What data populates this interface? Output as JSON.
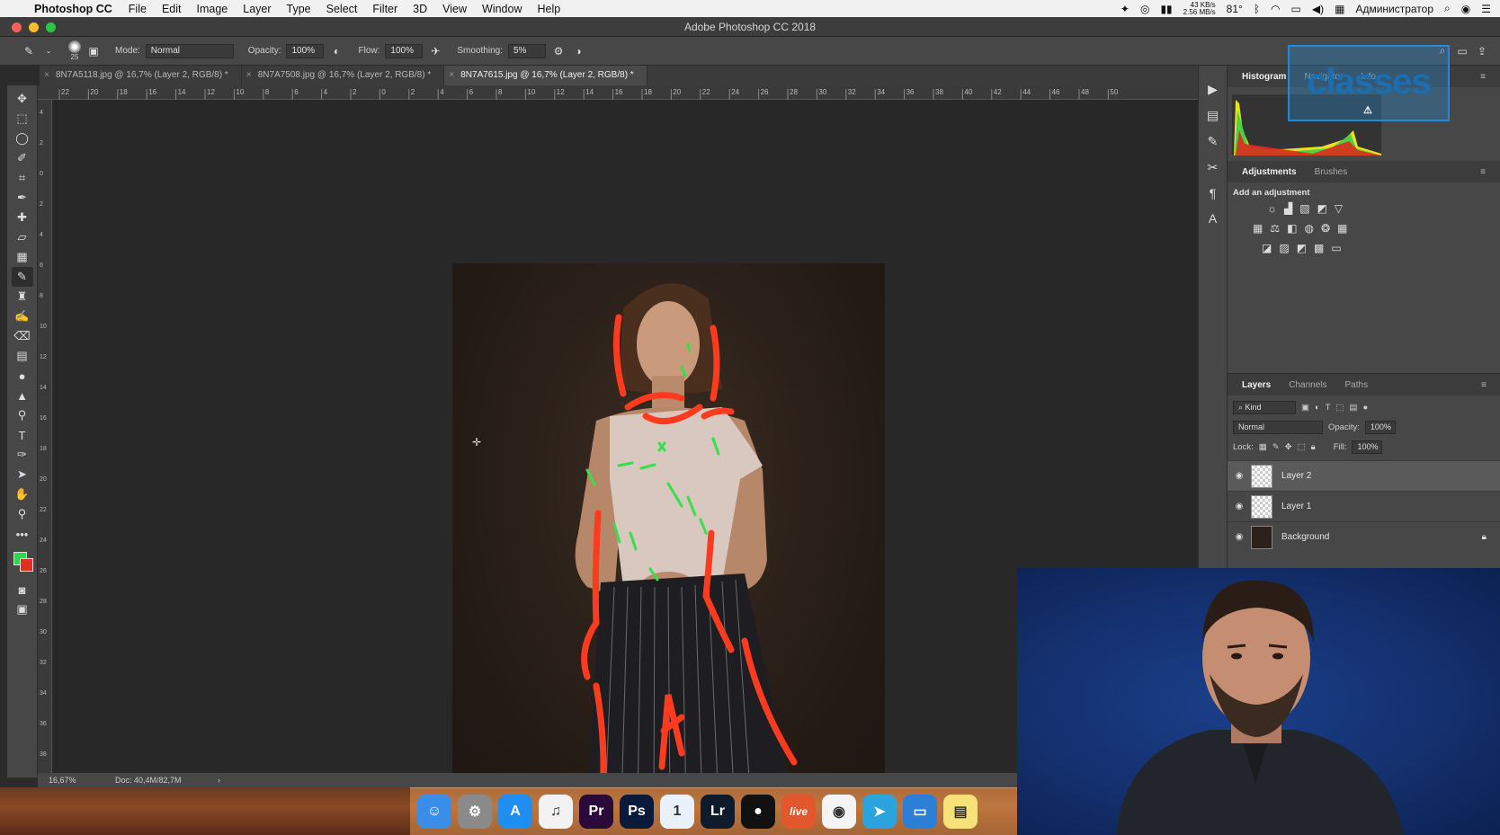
{
  "menubar": {
    "app_name": "Photoshop CC",
    "items": [
      "File",
      "Edit",
      "Image",
      "Layer",
      "Type",
      "Select",
      "Filter",
      "3D",
      "View",
      "Window",
      "Help"
    ],
    "net_up": "43 KB/s",
    "net_down": "2.56 MB/s",
    "temp": "81°",
    "user": "Администратор"
  },
  "window": {
    "title": "Adobe Photoshop CC 2018"
  },
  "options": {
    "brush_size": "25",
    "mode_label": "Mode:",
    "mode_value": "Normal",
    "opacity_label": "Opacity:",
    "opacity_value": "100%",
    "flow_label": "Flow:",
    "flow_value": "100%",
    "smoothing_label": "Smoothing:",
    "smoothing_value": "5%"
  },
  "tabs": [
    {
      "label": "8N7A5118.jpg @ 16,7% (Layer 2, RGB/8) *",
      "active": false
    },
    {
      "label": "8N7A7508.jpg @ 16,7% (Layer 2, RGB/8) *",
      "active": false
    },
    {
      "label": "8N7A7615.jpg @ 16,7% (Layer 2, RGB/8) *",
      "active": true
    }
  ],
  "ruler": {
    "top_labels": [
      "22",
      "20",
      "18",
      "16",
      "14",
      "12",
      "10",
      "8",
      "6",
      "4",
      "2",
      "0",
      "2",
      "4",
      "6",
      "8",
      "10",
      "12",
      "14",
      "16",
      "18",
      "20",
      "22",
      "24",
      "26",
      "28",
      "30",
      "32",
      "34",
      "36",
      "38",
      "40",
      "42",
      "44",
      "46",
      "48",
      "50"
    ],
    "left_labels": [
      "4",
      "2",
      "0",
      "2",
      "4",
      "6",
      "8",
      "1 0",
      "1 2",
      "1 4",
      "1 6",
      "1 8",
      "2 0",
      "2 2",
      "2 4",
      "2 6",
      "2 8",
      "3 0",
      "3 2",
      "3 4",
      "3 6",
      "3 8"
    ]
  },
  "status": {
    "zoom": "16,67%",
    "doc": "Doc: 40,4M/82,7M"
  },
  "colors": {
    "foreground": "#2ed74b",
    "background": "#e03020",
    "stroke_red": "#ff3b1f",
    "stroke_green": "#35e04a"
  },
  "panels": {
    "top_tabs": [
      "Histogram",
      "Navigator",
      "Info"
    ],
    "mid_tabs": [
      "Adjustments",
      "Brushes"
    ],
    "add_adjustment": "Add an adjustment",
    "layer_tabs": [
      "Layers",
      "Channels",
      "Paths"
    ],
    "kind_label": "Kind",
    "blend_mode": "Normal",
    "opacity_label": "Opacity:",
    "opacity_value": "100%",
    "lock_label": "Lock:",
    "fill_label": "Fill:",
    "fill_value": "100%",
    "layers": [
      {
        "name": "Layer 2",
        "active": true,
        "locked": false
      },
      {
        "name": "Layer 1",
        "active": false,
        "locked": false
      },
      {
        "name": "Background",
        "active": false,
        "locked": true
      }
    ]
  },
  "overlay_logo": "classes",
  "dock_apps": [
    {
      "name": "finder-icon",
      "glyph": "☺",
      "color": "#3b8ee8"
    },
    {
      "name": "system-preferences-icon",
      "glyph": "⚙",
      "color": "#8a8a8a"
    },
    {
      "name": "app-store-icon",
      "glyph": "A",
      "color": "#1e8ef0"
    },
    {
      "name": "itunes-icon",
      "glyph": "♫",
      "color": "#f2f2f2"
    },
    {
      "name": "premiere-icon",
      "glyph": "Pr",
      "color": "#2a0a3a"
    },
    {
      "name": "photoshop-icon",
      "glyph": "Ps",
      "color": "#0a1a3a"
    },
    {
      "name": "onepassword-icon",
      "glyph": "1",
      "color": "#e9f2fb"
    },
    {
      "name": "lightroom-icon",
      "glyph": "Lr",
      "color": "#0d1b2a"
    },
    {
      "name": "app-black-icon",
      "glyph": "●",
      "color": "#111111"
    },
    {
      "name": "live-app-icon",
      "glyph": "live",
      "color": "#e2572b"
    },
    {
      "name": "chrome-icon",
      "glyph": "◉",
      "color": "#f4f4f4"
    },
    {
      "name": "telegram-icon",
      "glyph": "➤",
      "color": "#2aa3df"
    },
    {
      "name": "keynote-icon",
      "glyph": "▭",
      "color": "#2c7fd6"
    },
    {
      "name": "notes-icon",
      "glyph": "▤",
      "color": "#f7e27a"
    }
  ]
}
